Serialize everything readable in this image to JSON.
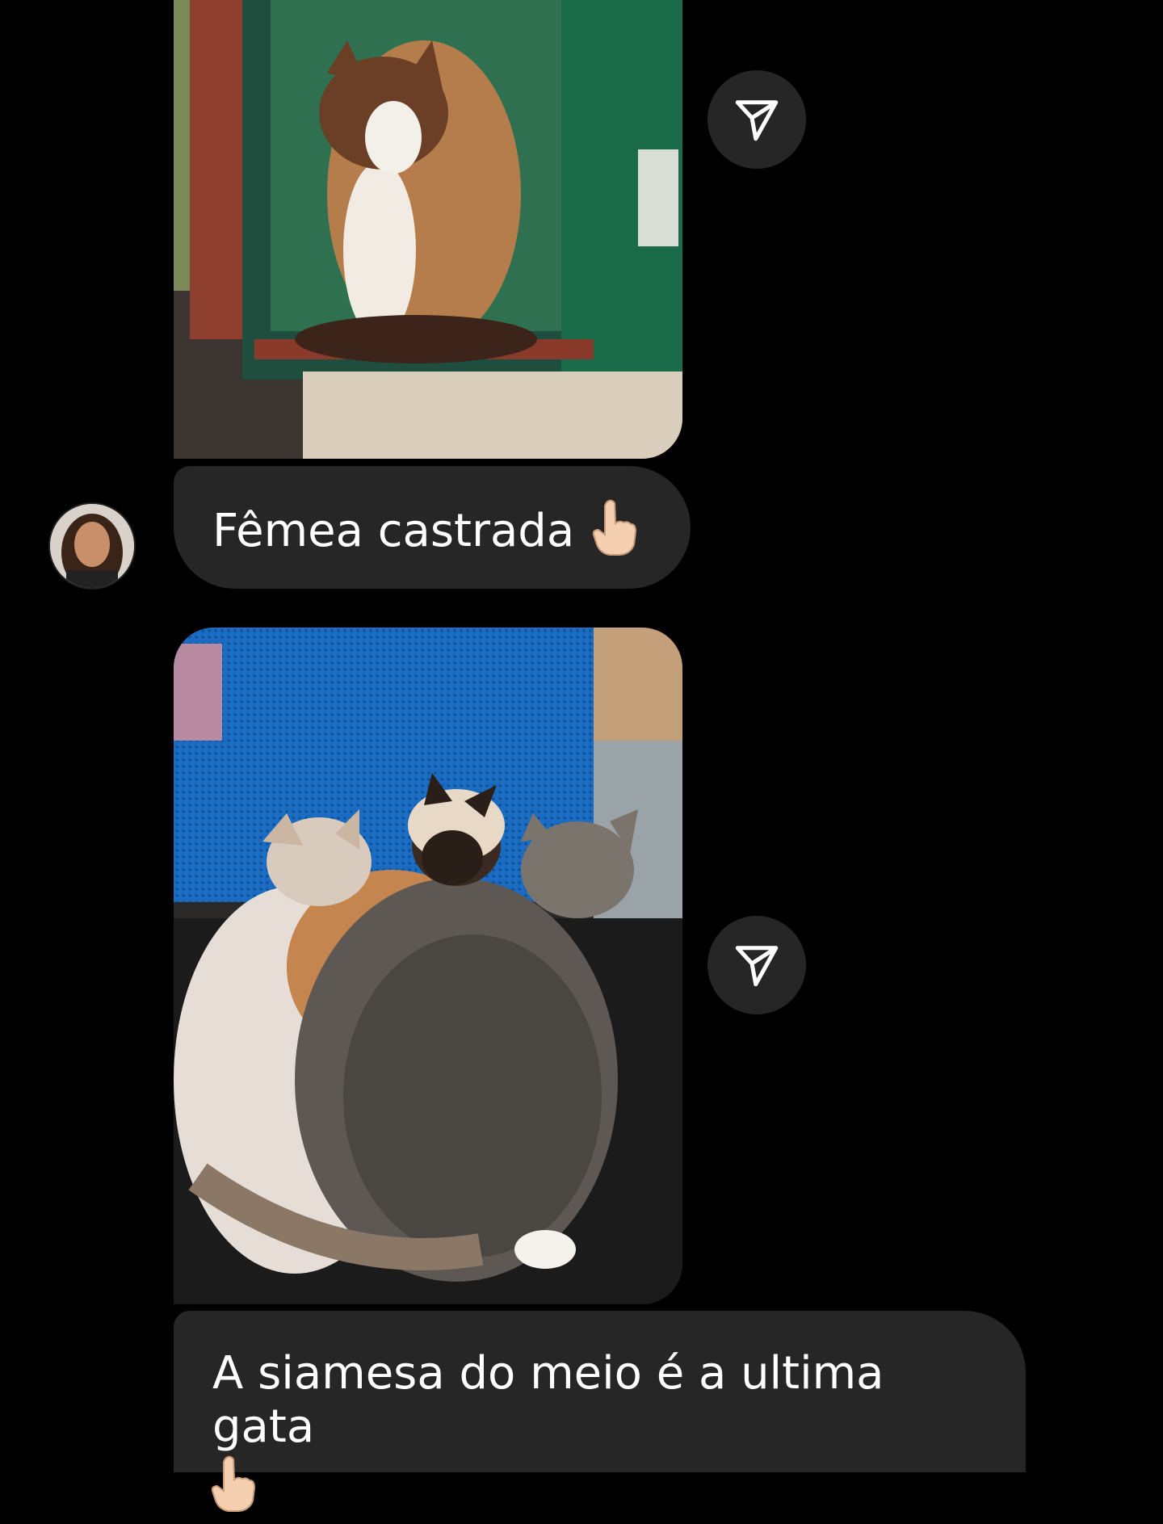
{
  "messages": [
    {
      "type": "photo",
      "description": "cat-in-green-box"
    },
    {
      "type": "text",
      "text": "Fêmea castrada",
      "emoji": "backhand-index-pointing-up"
    },
    {
      "type": "photo",
      "description": "three-cats-on-blue-chair"
    },
    {
      "type": "text",
      "text": "A siamesa do meio é a ultima gata",
      "emoji": "backhand-index-pointing-up"
    }
  ],
  "icons": {
    "share": "paper-plane-icon",
    "hand": "pointing-up-hand-icon"
  },
  "colors": {
    "background": "#000000",
    "bubble": "#262626",
    "text": "#ffffff"
  }
}
